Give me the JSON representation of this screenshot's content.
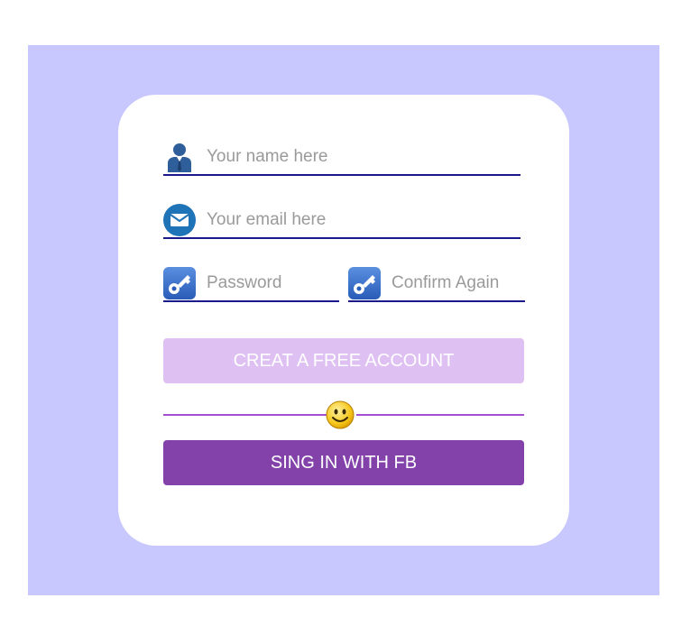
{
  "form": {
    "name_placeholder": "Your name here",
    "email_placeholder": "Your email here",
    "password_placeholder": "Password",
    "confirm_placeholder": "Confirm Again",
    "create_label": "CREAT A FREE ACCOUNT",
    "fb_label": "SING IN WITH FB"
  },
  "icons": {
    "name": "user-icon",
    "email": "envelope-icon",
    "password": "key-icon",
    "confirm": "key-icon",
    "divider": "smiley-icon"
  },
  "colors": {
    "backdrop": "#c8c8fe",
    "underline": "#1a1a8c",
    "create_button": "#dfc0f3",
    "fb_button": "#8242aa",
    "divider_line": "#a24fd0"
  }
}
